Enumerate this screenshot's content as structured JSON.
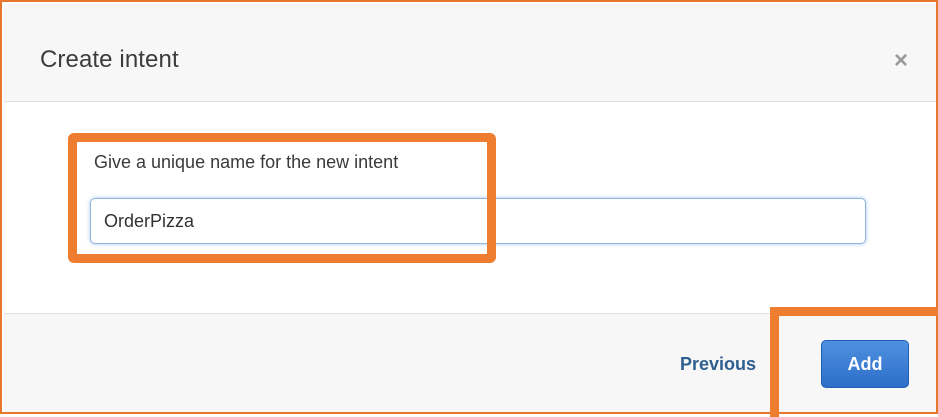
{
  "dialog": {
    "title": "Create intent",
    "close_glyph": "×",
    "close_icon": "close-icon"
  },
  "form": {
    "label": "Give a unique name for the new intent",
    "input_value": "OrderPizza"
  },
  "footer": {
    "previous_label": "Previous",
    "add_label": "Add"
  },
  "colors": {
    "annotation_highlight": "#ee7d2f",
    "primary_button": "#2d6fc9",
    "link": "#2e5f8f"
  }
}
